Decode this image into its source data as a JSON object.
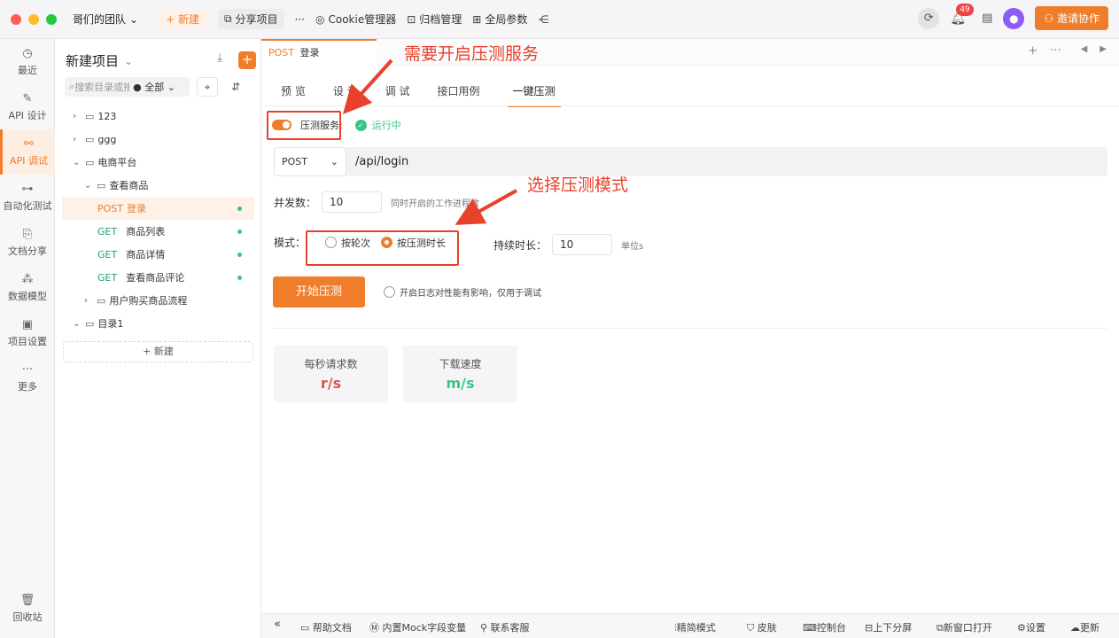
{
  "colors": {
    "accent": "#f07d2a",
    "success": "#39c684",
    "annotation": "#e8412c",
    "rps": "#e0524d",
    "speed": "#39c684"
  },
  "topbar": {
    "team_name": "哥们的团队",
    "new_label": "+ 新建",
    "share_label": "分享项目",
    "more_label": "···",
    "cookie_label": "Cookie管理器",
    "archive_label": "归档管理",
    "global_params_label": "全局参数",
    "notification_count": "49",
    "invite_label": "邀请协作"
  },
  "nav": {
    "recent": "最近",
    "api_design": "API 设计",
    "api_debug": "API 调试",
    "auto_test": "自动化测试",
    "doc_share": "文档分享",
    "data_model": "数据模型",
    "project_settings": "项目设置",
    "more": "更多",
    "trash": "回收站"
  },
  "tree": {
    "title": "新建项目",
    "search_placeholder": "搜索目录或接口",
    "filter_value": "全部",
    "folder_123": "123",
    "folder_ggg": "ggg",
    "folder_shop": "电商平台",
    "folder_view": "查看商品",
    "post_method": "POST",
    "post_name": "登录",
    "get_method": "GET",
    "get_list": "商品列表",
    "get_detail": "商品详情",
    "get_comments": "查看商品评论",
    "folder_flow": "用户购买商品流程",
    "folder_dir1": "目录1",
    "new_label": "新建"
  },
  "tab": {
    "method": "POST",
    "name": "登录"
  },
  "subtabs": {
    "preview": "预 览",
    "design": "设 计",
    "debug": "调 试",
    "cases": "接口用例",
    "stress": "一键压测"
  },
  "service": {
    "label": "压测服务:",
    "status": "运行中"
  },
  "request": {
    "method": "POST",
    "url": "/api/login"
  },
  "concurrency": {
    "label": "并发数：",
    "value": "10",
    "hint": "同时开启的工作进程数"
  },
  "mode": {
    "label": "模式：",
    "by_count": "按轮次",
    "by_duration": "按压测时长"
  },
  "duration": {
    "label": "持续时长：",
    "value": "10",
    "unit": "单位s"
  },
  "start_label": "开始压测",
  "log_label": "开启日志对性能有影响，仅用于调试",
  "stats": {
    "rps_label": "每秒请求数",
    "rps_unit": "r/s",
    "speed_label": "下载速度",
    "speed_unit": "m/s"
  },
  "annotations": {
    "top": "需要开启压测服务",
    "mode": "选择压测模式"
  },
  "bottombar": {
    "collapse": "«",
    "help": "帮助文档",
    "mock": "内置Mock字段变量",
    "support": "联系客服",
    "compact": "精简模式",
    "skin": "皮肤",
    "console": "控制台",
    "split": "上下分屏",
    "new_window": "新窗口打开",
    "settings": "设置",
    "update": "更新"
  }
}
